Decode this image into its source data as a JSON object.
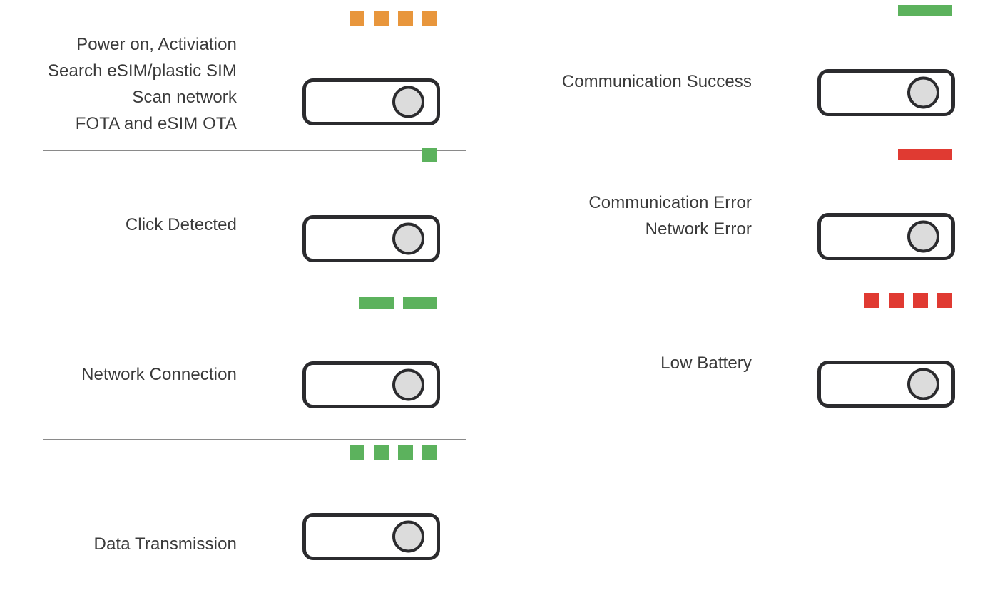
{
  "palette": {
    "orange": "#e8963c",
    "green": "#5cb25d",
    "red": "#e03a32",
    "device_outline": "#2b2b2e",
    "knob_fill": "#dcdcdc",
    "text": "#3a3a3a",
    "divider": "#8a8a8a",
    "background": "#ffffff"
  },
  "columns": {
    "left": {
      "rows": [
        {
          "id": "power-on",
          "label_lines": [
            "Power on, Activiation",
            "Search eSIM/plastic SIM",
            "Scan network",
            "FOTA and eSIM OTA"
          ],
          "leds": {
            "color_name": "orange",
            "color": "#e8963c",
            "shape": "square",
            "count": 4
          }
        },
        {
          "id": "click-detected",
          "label_lines": [
            "Click Detected"
          ],
          "leds": {
            "color_name": "green",
            "color": "#5cb25d",
            "shape": "square",
            "count": 1
          }
        },
        {
          "id": "network-connection",
          "label_lines": [
            "Network Connection"
          ],
          "leds": {
            "color_name": "green",
            "color": "#5cb25d",
            "shape": "bar",
            "count": 2
          }
        },
        {
          "id": "data-transmission",
          "label_lines": [
            "Data Transmission"
          ],
          "leds": {
            "color_name": "green",
            "color": "#5cb25d",
            "shape": "square",
            "count": 4
          }
        }
      ]
    },
    "right": {
      "rows": [
        {
          "id": "communication-success",
          "label_lines": [
            "Communication Success"
          ],
          "leds": {
            "color_name": "green",
            "color": "#5cb25d",
            "shape": "wide",
            "count": 1
          }
        },
        {
          "id": "communication-error",
          "label_lines": [
            "Communication Error",
            "Network Error"
          ],
          "leds": {
            "color_name": "red",
            "color": "#e03a32",
            "shape": "wide",
            "count": 1
          }
        },
        {
          "id": "low-battery",
          "label_lines": [
            "Low Battery"
          ],
          "leds": {
            "color_name": "red",
            "color": "#e03a32",
            "shape": "square",
            "count": 4
          }
        }
      ]
    }
  }
}
